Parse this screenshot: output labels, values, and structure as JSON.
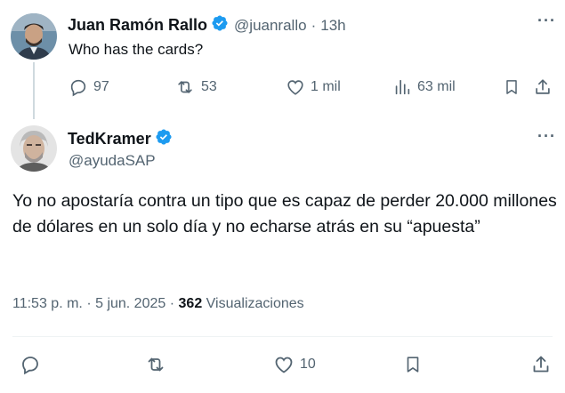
{
  "reply_to": {
    "author_name": "Juan Ramón Rallo",
    "handle": "@juanrallo",
    "separator": "·",
    "time": "13h",
    "text": "Who has the cards?",
    "stats": {
      "replies": "97",
      "reposts": "53",
      "likes": "1 mil",
      "views": "63 mil"
    }
  },
  "main": {
    "author_name": "TedKramer",
    "handle": "@ayudaSAP",
    "text": "Yo no apostaría contra un tipo que es capaz de perder 20.000 millones de dólares en un solo día y no echarse atrás en su “apuesta”",
    "time": "11:53 p. m.",
    "dot1": "·",
    "date": "5 jun. 2025",
    "dot2": "·",
    "views_count": "362",
    "views_label": "Visualizaciones",
    "stats": {
      "likes": "10"
    }
  },
  "colors": {
    "verified_badge": "#1d9bf0",
    "text_primary": "#0f1419",
    "text_secondary": "#536471",
    "thread_line": "#cfd9de"
  },
  "icons": [
    "verified-icon",
    "more-icon",
    "reply-icon",
    "repost-icon",
    "like-icon",
    "views-icon",
    "bookmark-icon",
    "share-icon"
  ]
}
